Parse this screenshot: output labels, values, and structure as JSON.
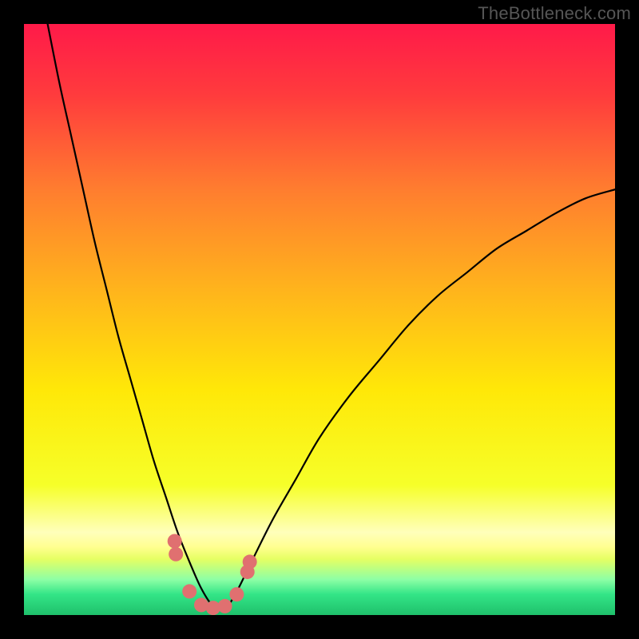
{
  "watermark": "TheBottleneck.com",
  "chart_data": {
    "type": "line",
    "title": "",
    "xlabel": "",
    "ylabel": "",
    "xlim": [
      0,
      100
    ],
    "ylim": [
      0,
      100
    ],
    "gradient_stops": [
      {
        "offset": 0.0,
        "color": "#ff1a49"
      },
      {
        "offset": 0.12,
        "color": "#ff3b3d"
      },
      {
        "offset": 0.28,
        "color": "#ff7d2f"
      },
      {
        "offset": 0.45,
        "color": "#ffb41c"
      },
      {
        "offset": 0.62,
        "color": "#ffe808"
      },
      {
        "offset": 0.78,
        "color": "#f6ff29"
      },
      {
        "offset": 0.86,
        "color": "#ffffbb"
      },
      {
        "offset": 0.885,
        "color": "#ffff90"
      },
      {
        "offset": 0.905,
        "color": "#e6ff63"
      },
      {
        "offset": 0.94,
        "color": "#8dffa5"
      },
      {
        "offset": 0.965,
        "color": "#33e587"
      },
      {
        "offset": 1.0,
        "color": "#1fc06b"
      }
    ],
    "series": [
      {
        "name": "bottleneck-curve",
        "description": "V-shaped curve approaching zero near x≈32 then rising sharply",
        "x": [
          4,
          6,
          8,
          10,
          12,
          14,
          16,
          18,
          20,
          22,
          24,
          26,
          28,
          30,
          32,
          34,
          36,
          38,
          42,
          46,
          50,
          55,
          60,
          65,
          70,
          75,
          80,
          85,
          90,
          95,
          100
        ],
        "y": [
          100,
          90,
          81,
          72,
          63,
          55,
          47,
          40,
          33,
          26,
          20,
          14,
          9,
          4.5,
          1.5,
          1,
          4,
          8,
          16,
          23,
          30,
          37,
          43,
          49,
          54,
          58,
          62,
          65,
          68,
          70.5,
          72
        ]
      }
    ],
    "markers": {
      "name": "threshold-markers",
      "color": "#e07070",
      "radius": 9,
      "points": [
        {
          "x": 25.5,
          "y": 12.5
        },
        {
          "x": 25.7,
          "y": 10.3
        },
        {
          "x": 28.0,
          "y": 4.0
        },
        {
          "x": 30.0,
          "y": 1.7
        },
        {
          "x": 32.0,
          "y": 1.2
        },
        {
          "x": 34.0,
          "y": 1.5
        },
        {
          "x": 36.0,
          "y": 3.5
        },
        {
          "x": 37.8,
          "y": 7.3
        },
        {
          "x": 38.2,
          "y": 9.0
        }
      ]
    }
  }
}
